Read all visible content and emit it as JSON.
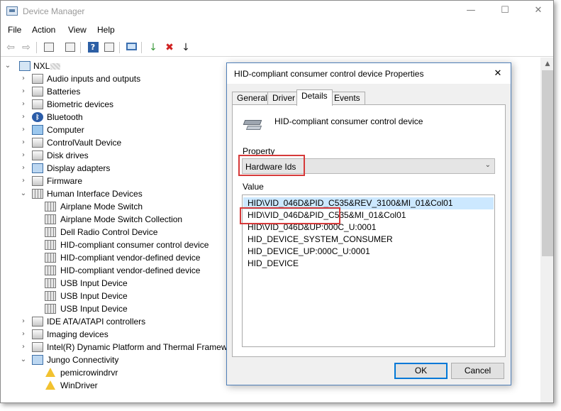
{
  "window": {
    "title": "Device Manager",
    "controls": {
      "minimize": "—",
      "maximize": "☐",
      "close": "✕"
    }
  },
  "menu": [
    "File",
    "Action",
    "View",
    "Help"
  ],
  "toolbar": {
    "back": "⇦",
    "forward": "⇨",
    "help_glyph": "?",
    "remove_glyph": "✖",
    "update_glyph": "↓"
  },
  "tree": {
    "root_label": "NXL",
    "root_masked": true,
    "categories": [
      "Audio inputs and outputs",
      "Batteries",
      "Biometric devices",
      "Bluetooth",
      "Computer",
      "ControlVault Device",
      "Disk drives",
      "Display adapters",
      "Firmware",
      "Human Interface Devices"
    ],
    "hid_children": [
      "Airplane Mode Switch",
      "Airplane Mode Switch Collection",
      "Dell Radio Control Device",
      "HID-compliant consumer control device",
      "HID-compliant vendor-defined device",
      "HID-compliant vendor-defined device",
      "USB Input Device",
      "USB Input Device",
      "USB Input Device"
    ],
    "more_categories": [
      "IDE ATA/ATAPI controllers",
      "Imaging devices",
      "Intel(R) Dynamic Platform and Thermal Framewo",
      "Jungo Connectivity"
    ],
    "jungo_children": [
      "pemicrowindrvr",
      "WinDriver"
    ]
  },
  "dialog": {
    "title": "HID-compliant consumer control device Properties",
    "close_glyph": "✕",
    "tabs": [
      "General",
      "Driver",
      "Details",
      "Events"
    ],
    "active_tab": "Details",
    "device_name": "HID-compliant consumer control device",
    "property_label": "Property",
    "property_value": "Hardware Ids",
    "dropdown_glyph": "⌄",
    "value_label": "Value",
    "values": [
      "HID\\VID_046D&PID_C535&REV_3100&MI_01&Col01",
      "HID\\VID_046D&PID_C535&MI_01&Col01",
      "HID\\VID_046D&UP:000C_U:0001",
      "HID_DEVICE_SYSTEM_CONSUMER",
      "HID_DEVICE_UP:000C_U:0001",
      "HID_DEVICE"
    ],
    "selected_value_index": 0,
    "ok_label": "OK",
    "cancel_label": "Cancel"
  },
  "colors": {
    "selection": "#cce8ff",
    "highlight_box": "#d63a3a",
    "ok_border": "#0078d7"
  }
}
